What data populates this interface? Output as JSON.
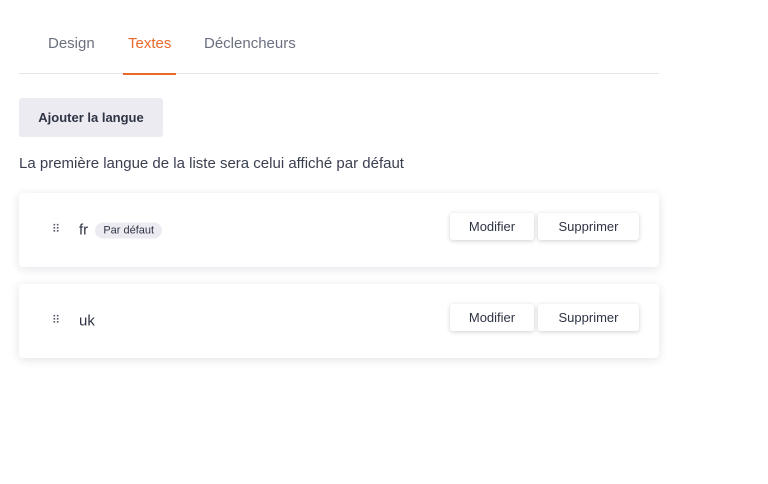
{
  "tabs": {
    "design": "Design",
    "textes": "Textes",
    "declencheurs": "Déclencheurs",
    "active": "Textes"
  },
  "actions": {
    "add_language": "Ajouter la langue"
  },
  "hint": "La première langue de la liste sera celui affiché par défaut",
  "languages": [
    {
      "code": "fr",
      "badge": "Par défaut",
      "edit_label": "Modifier",
      "delete_label": "Supprimer"
    },
    {
      "code": "uk",
      "edit_label": "Modifier",
      "delete_label": "Supprimer"
    }
  ],
  "colors": {
    "accent": "#e8692a",
    "button_bg": "#ecebf1",
    "text": "#2f3445"
  },
  "icons": {
    "drag_handle": "drag-handle-icon"
  }
}
